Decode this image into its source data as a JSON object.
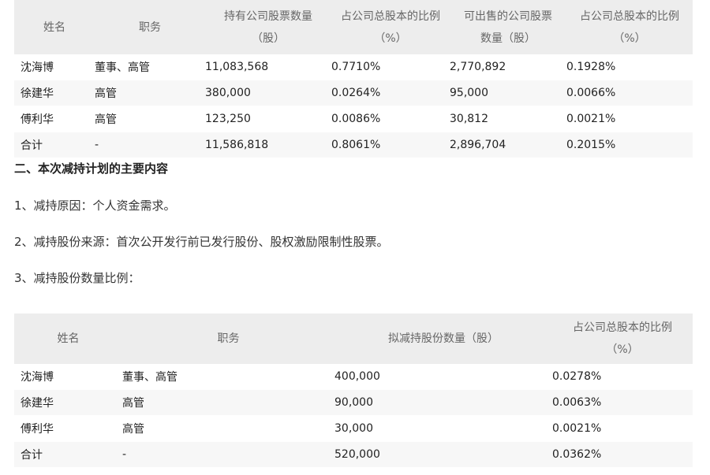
{
  "table1": {
    "headers": [
      "姓名",
      "职务",
      "持有公司股票数量（股）",
      "占公司总股本的比例（%）",
      "可出售的公司股票数量（股）",
      "占公司总股本的比例（%）"
    ],
    "header_lines": [
      [
        "姓名"
      ],
      [
        "职务"
      ],
      [
        "持有公司股票数量",
        "（股）"
      ],
      [
        "占公司总股本的比例",
        "（%）"
      ],
      [
        "可出售的公司股票",
        "数量（股）"
      ],
      [
        "占公司总股本的比例",
        "（%）"
      ]
    ],
    "rows": [
      [
        "沈海博",
        "董事、高管",
        "11,083,568",
        "0.7710%",
        "2,770,892",
        "0.1928%"
      ],
      [
        "徐建华",
        "高管",
        "380,000",
        "0.0264%",
        "95,000",
        "0.0066%"
      ],
      [
        "傅利华",
        "高管",
        "123,250",
        "0.0086%",
        "30,812",
        "0.0021%"
      ],
      [
        "合计",
        "-",
        "11,586,818",
        "0.8061%",
        "2,896,704",
        "0.2015%"
      ]
    ]
  },
  "section_heading": "二、本次减持计划的主要内容",
  "item1": "1、减持原因：个人资金需求。",
  "item2": "2、减持股份来源：首次公开发行前已发行股份、股权激励限制性股票。",
  "item3": "3、减持股份数量比例：",
  "table2": {
    "header_lines": [
      [
        "姓名"
      ],
      [
        "职务"
      ],
      [
        "拟减持股份数量（股）"
      ],
      [
        "占公司总股本的比例",
        "（%）"
      ]
    ],
    "rows": [
      [
        "沈海博",
        "董事、高管",
        "400,000",
        "0.0278%"
      ],
      [
        "徐建华",
        "高管",
        "90,000",
        "0.0063%"
      ],
      [
        "傅利华",
        "高管",
        "30,000",
        "0.0021%"
      ],
      [
        "合计",
        "-",
        "520,000",
        "0.0362%"
      ]
    ]
  }
}
